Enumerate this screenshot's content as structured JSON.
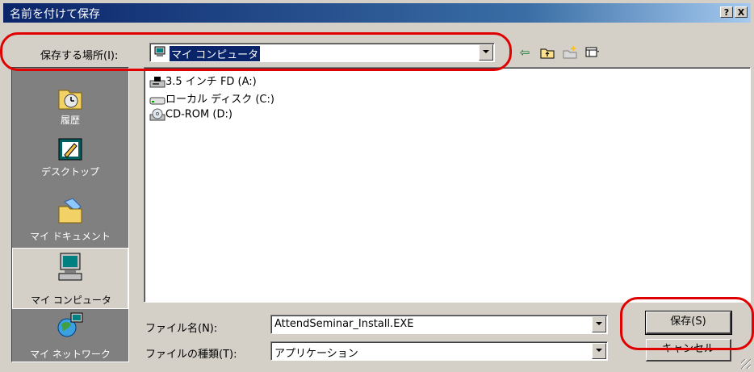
{
  "window": {
    "title": "名前を付けて保存",
    "help_label": "?",
    "close_label": "X"
  },
  "location": {
    "label": "保存する場所(I):",
    "value": "マイ コンピュータ"
  },
  "toolbar": {
    "back_icon": "back-arrow-icon",
    "up_icon": "up-folder-icon",
    "newfolder_icon": "new-folder-icon",
    "view_icon": "view-menu-icon"
  },
  "places": [
    {
      "label": "履歴",
      "icon": "history-icon"
    },
    {
      "label": "デスクトップ",
      "icon": "desktop-icon"
    },
    {
      "label": "マイ ドキュメント",
      "icon": "my-documents-icon"
    },
    {
      "label": "マイ コンピュータ",
      "icon": "my-computer-icon",
      "selected": true
    },
    {
      "label": "マイ ネットワーク",
      "icon": "my-network-icon"
    }
  ],
  "drives": [
    {
      "label": "3.5 インチ FD (A:)",
      "icon": "floppy-drive-icon"
    },
    {
      "label": "ローカル ディスク (C:)",
      "icon": "hard-disk-icon"
    },
    {
      "label": "CD-ROM (D:)",
      "icon": "cdrom-drive-icon"
    }
  ],
  "filename": {
    "label": "ファイル名(N):",
    "value": "AttendSeminar_Install.EXE"
  },
  "filetype": {
    "label": "ファイルの種類(T):",
    "value": "アプリケーション"
  },
  "buttons": {
    "save": "保存(S)",
    "cancel": "キャンセル"
  },
  "colors": {
    "highlight": "#e00000",
    "titlebar": "#0a246a",
    "dialog_bg": "#d4d0c8"
  }
}
